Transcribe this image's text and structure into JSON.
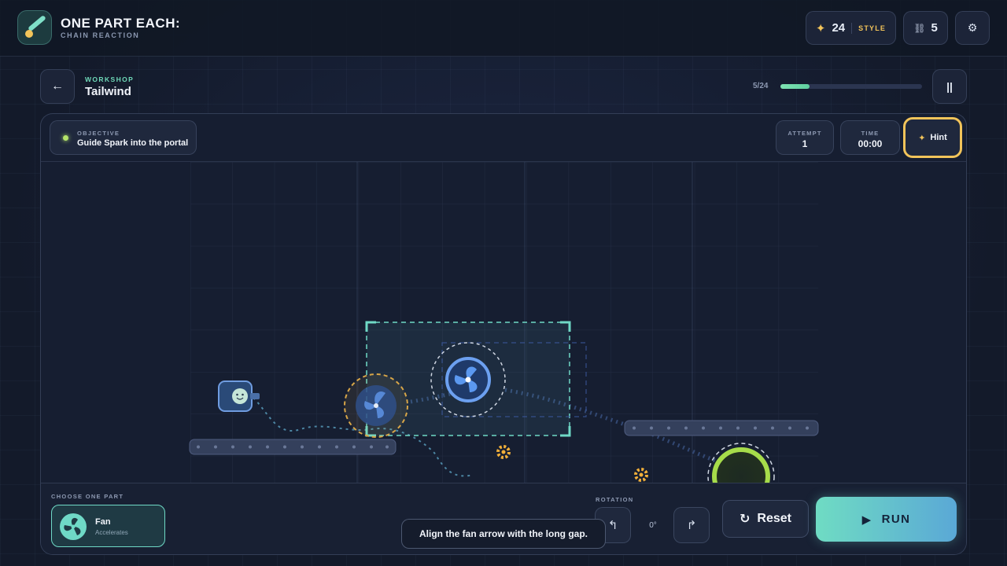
{
  "app": {
    "title": "ONE PART EACH:",
    "subtitle": "CHAIN REACTION",
    "style_points": "24",
    "style_label": "STYLE",
    "chain_count": "5",
    "icons": {
      "logo": "logo-icon",
      "star": "star-icon",
      "chain": "chain-icon",
      "settings": "gear-icon"
    },
    "glyphs": {
      "star": "✦",
      "chain": "⛓",
      "gear": "⚙"
    }
  },
  "level": {
    "category": "WORKSHOP",
    "name": "Tailwind",
    "progress_text": "5/24",
    "progress_fraction": 0.2083,
    "back_glyph": "←",
    "pause_glyph": "⏸"
  },
  "hud": {
    "objective_label": "OBJECTIVE",
    "objective_text": "Guide Spark into the portal",
    "attempt_label": "ATTEMPT",
    "attempt_value": "1",
    "time_label": "TIME",
    "time_value": "00:00",
    "hint_label": "Hint",
    "hint_glyph": "✦"
  },
  "tray": {
    "choose_label": "CHOOSE ONE PART",
    "part_name": "Fan",
    "part_desc": "Accelerates",
    "rotation_label": "ROTATION",
    "rotation_value": "0°",
    "rotate_left_glyph": "↰",
    "rotate_right_glyph": "↱",
    "reset_label": "Reset",
    "reset_glyph": "↻",
    "run_label": "RUN",
    "run_glyph": "▶"
  },
  "toast": {
    "text": "Align the fan arrow with the long gap."
  },
  "colors": {
    "accent_teal": "#6fd9c6",
    "hint_gold": "#f2c45a",
    "fan_blue": "#5b8fe0",
    "portal_green": "#a6dc4a",
    "progress_green": "#7fe3b3"
  }
}
